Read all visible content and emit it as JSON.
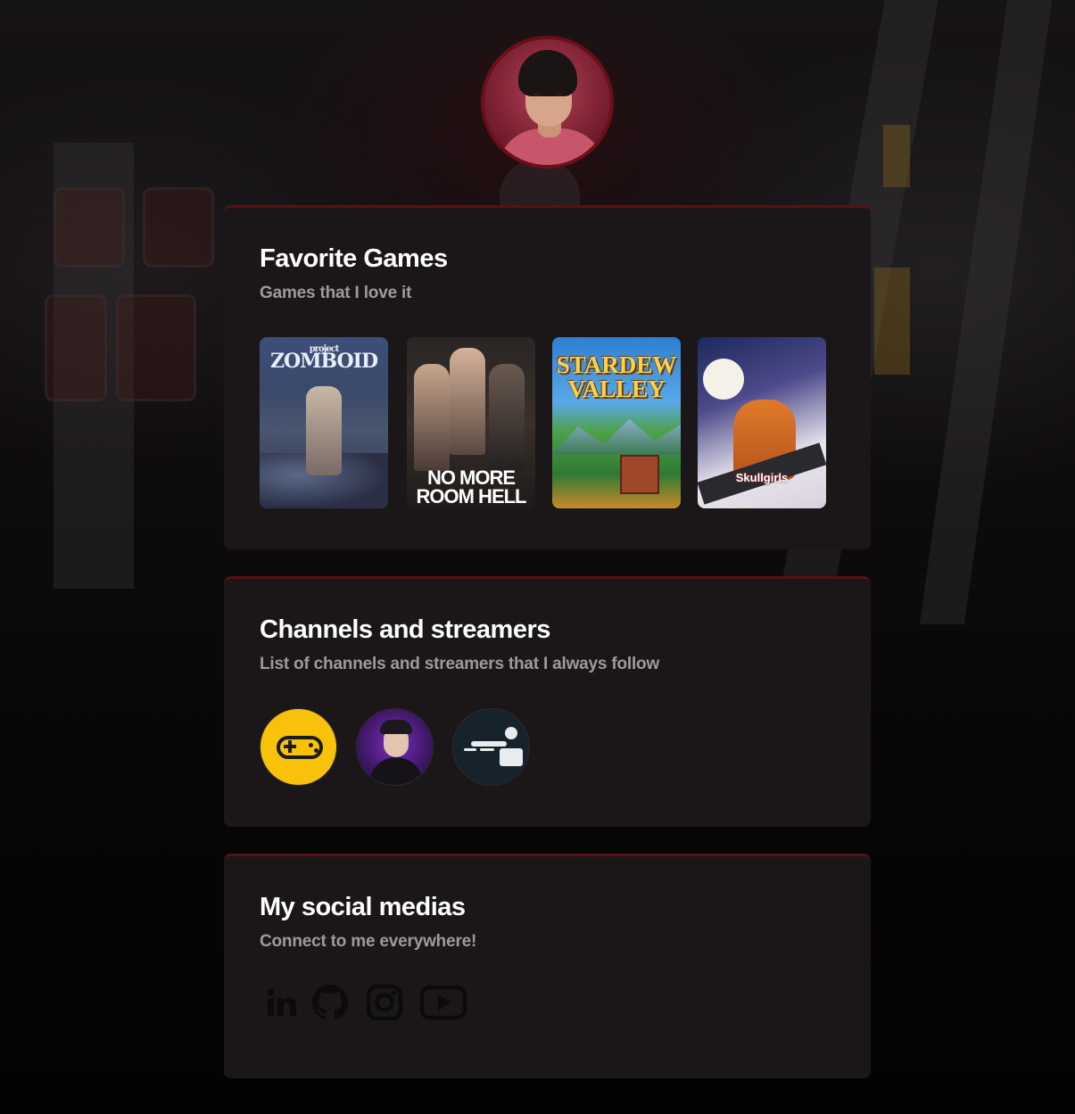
{
  "profile": {
    "avatar_alt": "Profile photo"
  },
  "favorite_games": {
    "title": "Favorite Games",
    "subtitle": "Games that I love it",
    "games": [
      {
        "name": "Project Zomboid",
        "logo_text_top": "project",
        "logo_text": "ZOMBOID"
      },
      {
        "name": "No More Room in Hell",
        "logo_line1": "NO MORE",
        "logo_line2": "ROOM HELL"
      },
      {
        "name": "Stardew Valley",
        "logo_line1": "STARDEW",
        "logo_line2": "VALLEY"
      },
      {
        "name": "Skullgirls",
        "logo_text": "Skullgirls"
      }
    ]
  },
  "channels": {
    "title": "Channels and streamers",
    "subtitle": "List of channels and streamers that I always follow",
    "items": [
      {
        "name": "channel-gamepad",
        "accent": "#f8c20b"
      },
      {
        "name": "channel-streamer",
        "accent": "#7a2fc0"
      },
      {
        "name": "channel-runner",
        "accent": "#16232d"
      }
    ]
  },
  "social": {
    "title": "My social medias",
    "subtitle": "Connect to me everywhere!",
    "links": [
      {
        "icon": "linkedin-icon"
      },
      {
        "icon": "github-icon"
      },
      {
        "icon": "instagram-icon"
      },
      {
        "icon": "youtube-icon"
      }
    ]
  },
  "colors": {
    "card_bg": "#1b1719",
    "card_accent": "#5d0e16",
    "title": "#ffffff",
    "subtitle": "#9d9a9f",
    "icon": "#0b0b0c"
  }
}
